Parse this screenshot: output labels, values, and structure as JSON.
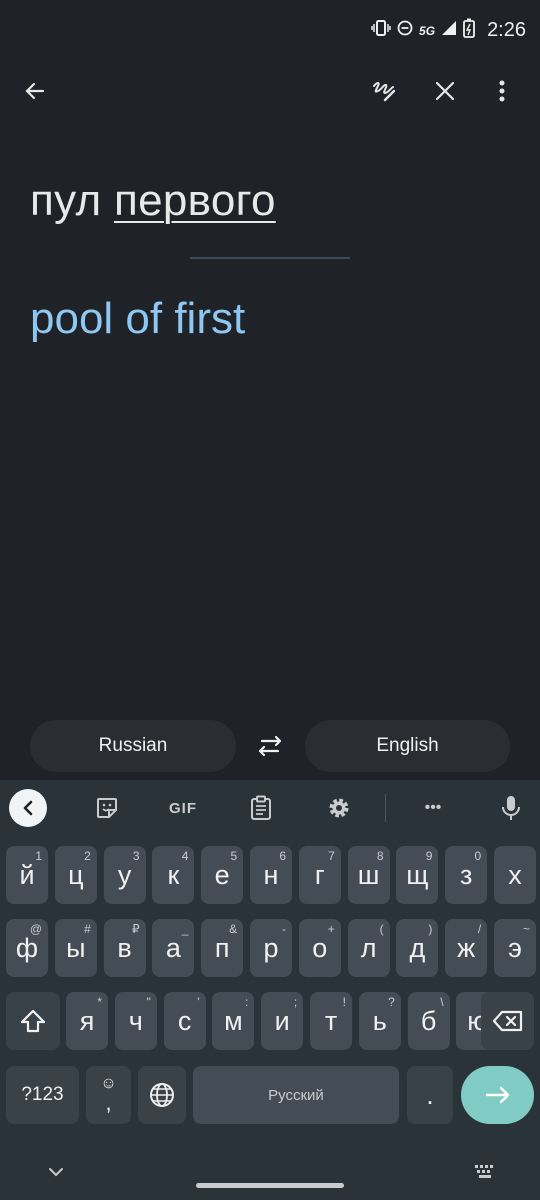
{
  "status": {
    "network": "5G",
    "time": "2:26"
  },
  "topbar": {
    "back_icon": "arrow-back-icon",
    "handwriting_icon": "handwriting-icon",
    "close_icon": "close-icon",
    "menu_icon": "more-vert-icon"
  },
  "translation": {
    "source_prefix": "пул",
    "source_underlined": "первого",
    "result": "pool of first"
  },
  "languages": {
    "source": "Russian",
    "target": "English",
    "swap_icon": "swap-arrows-icon"
  },
  "keyboard": {
    "toolbar": {
      "gif_label": "GIF",
      "more_label": "•••"
    },
    "row1": [
      {
        "label": "й",
        "hint": "1"
      },
      {
        "label": "ц",
        "hint": "2"
      },
      {
        "label": "у",
        "hint": "3"
      },
      {
        "label": "к",
        "hint": "4"
      },
      {
        "label": "е",
        "hint": "5"
      },
      {
        "label": "н",
        "hint": "6"
      },
      {
        "label": "г",
        "hint": "7"
      },
      {
        "label": "ш",
        "hint": "8"
      },
      {
        "label": "щ",
        "hint": "9"
      },
      {
        "label": "з",
        "hint": "0"
      },
      {
        "label": "х",
        "hint": ""
      }
    ],
    "row2": [
      {
        "label": "ф",
        "hint": "@"
      },
      {
        "label": "ы",
        "hint": "#"
      },
      {
        "label": "в",
        "hint": "₽"
      },
      {
        "label": "а",
        "hint": "_"
      },
      {
        "label": "п",
        "hint": "&"
      },
      {
        "label": "р",
        "hint": "-"
      },
      {
        "label": "о",
        "hint": "+"
      },
      {
        "label": "л",
        "hint": "("
      },
      {
        "label": "д",
        "hint": ")"
      },
      {
        "label": "ж",
        "hint": "/"
      },
      {
        "label": "э",
        "hint": "~"
      }
    ],
    "row3": [
      {
        "label": "я",
        "hint": "*"
      },
      {
        "label": "ч",
        "hint": "\""
      },
      {
        "label": "с",
        "hint": "'"
      },
      {
        "label": "м",
        "hint": ":"
      },
      {
        "label": "и",
        "hint": ";"
      },
      {
        "label": "т",
        "hint": "!"
      },
      {
        "label": "ь",
        "hint": "?"
      },
      {
        "label": "б",
        "hint": "\\"
      },
      {
        "label": "ю",
        "hint": "%"
      }
    ],
    "symbols_label": "?123",
    "emoji_comma_top": "☺",
    "emoji_comma_bottom": ",",
    "space_label": "Русский",
    "period_label": "."
  }
}
